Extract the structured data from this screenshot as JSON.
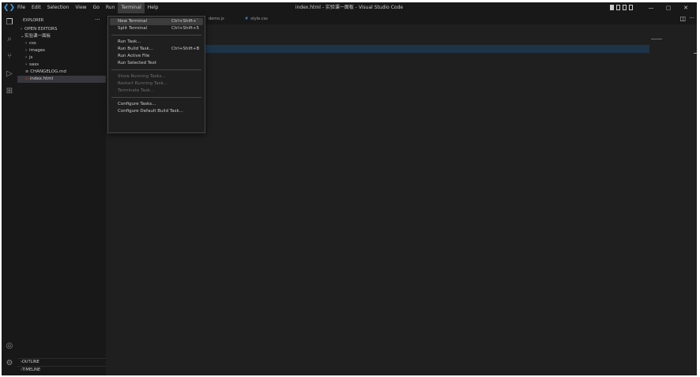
{
  "titlebar": {
    "menu": [
      "File",
      "Edit",
      "Selection",
      "View",
      "Go",
      "Run",
      "Terminal",
      "Help"
    ],
    "title": "index.html - 实验课一面板 - Visual Studio Code",
    "min": "—",
    "max": "▢",
    "close": "✕"
  },
  "sidebar": {
    "header": "EXPLORER",
    "more": "···",
    "open_editors": "OPEN EDITORS",
    "folder": "实验课一面板",
    "items": [
      "css",
      "images",
      "js",
      "sass",
      "CHANGELOG.md",
      "index.html"
    ],
    "outline": "OUTLINE",
    "timeline": "TIMELINE"
  },
  "tabs": [
    "demo.js",
    "style.css"
  ],
  "terminal_menu": {
    "items": [
      {
        "label": "New Terminal",
        "shortcut": "Ctrl+Shift+`"
      },
      {
        "label": "Split Terminal",
        "shortcut": "Ctrl+Shift+5"
      },
      {
        "label": "Run Task...",
        "shortcut": ""
      },
      {
        "label": "Run Build Task...",
        "shortcut": "Ctrl+Shift+B"
      },
      {
        "label": "Run Active File",
        "shortcut": ""
      },
      {
        "label": "Run Selected Text",
        "shortcut": ""
      },
      {
        "label": "Show Running Tasks...",
        "shortcut": ""
      },
      {
        "label": "Restart Running Task...",
        "shortcut": ""
      },
      {
        "label": "Terminate Task...",
        "shortcut": ""
      },
      {
        "label": "Configure Tasks...",
        "shortcut": ""
      },
      {
        "label": "Configure Default Build Task...",
        "shortcut": ""
      }
    ]
  },
  "colors": {
    "accent": "#3b9be8",
    "background": "#1e1e1e",
    "sidebar": "#181818",
    "menu_highlight": "#3c3c3c"
  }
}
